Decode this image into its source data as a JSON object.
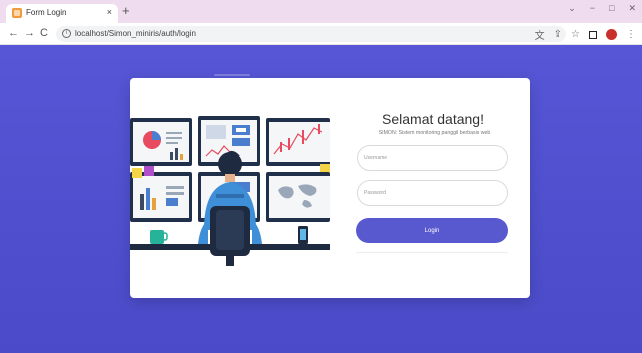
{
  "browser": {
    "tab_title": "Form Login",
    "tab_close": "×",
    "new_tab": "+",
    "back": "←",
    "forward": "→",
    "reload": "C",
    "url": "localhost/Simon_miniris/auth/login",
    "win_controls": [
      "⌄",
      "−",
      "□",
      "✕"
    ]
  },
  "login": {
    "title": "Selamat datang!",
    "subtitle": "SIMON: Sistem monitoring panggil berbasis web",
    "username_placeholder": "Username",
    "password_placeholder": "Password",
    "button_label": "Login"
  },
  "colors": {
    "page_background": "#5656d6",
    "button": "#5959cf",
    "tab_strip": "#f0dcef",
    "favicon": "#f39a3a"
  }
}
